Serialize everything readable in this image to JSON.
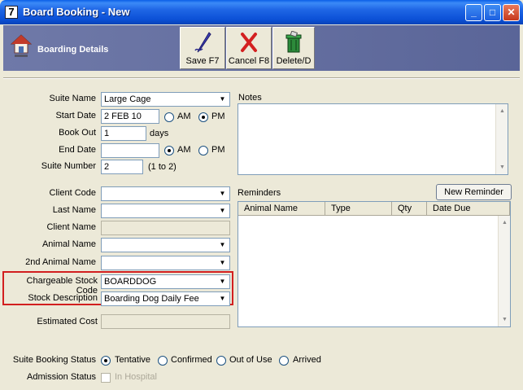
{
  "window": {
    "title": "Board Booking - New",
    "app_glyph": "7",
    "controls": {
      "minimize": "_",
      "maximize": "□",
      "close": "✕"
    }
  },
  "header": {
    "section_title": "Boarding Details",
    "icon": "house-icon",
    "toolbar": {
      "save_label": "Save F7",
      "cancel_label": "Cancel F8",
      "delete_label": "Delete/D"
    }
  },
  "form": {
    "suite_name": {
      "label": "Suite Name",
      "value": "Large Cage"
    },
    "start_date": {
      "label": "Start Date",
      "value": "2 FEB 10",
      "am": "AM",
      "pm": "PM",
      "selected": "PM"
    },
    "book_out": {
      "label": "Book Out",
      "value": "1",
      "unit": "days"
    },
    "end_date": {
      "label": "End Date",
      "value": "",
      "am": "AM",
      "pm": "PM",
      "selected": "AM"
    },
    "suite_number": {
      "label": "Suite Number",
      "value": "2",
      "range": "(1 to 2)"
    },
    "client_code": {
      "label": "Client Code",
      "value": ""
    },
    "last_name": {
      "label": "Last Name",
      "value": ""
    },
    "client_name": {
      "label": "Client Name",
      "value": ""
    },
    "animal_name": {
      "label": "Animal Name",
      "value": ""
    },
    "second_animal_name": {
      "label": "2nd Animal Name",
      "value": ""
    },
    "chargeable_stock_code": {
      "label": "Chargeable Stock Code",
      "value": "BOARDDOG"
    },
    "stock_description": {
      "label": "Stock Description",
      "value": "Boarding Dog Daily Fee"
    },
    "estimated_cost": {
      "label": "Estimated Cost",
      "value": ""
    }
  },
  "notes": {
    "label": "Notes"
  },
  "reminders": {
    "label": "Reminders",
    "new_button": "New Reminder",
    "columns": [
      "Animal Name",
      "Type",
      "Qty",
      "Date Due"
    ]
  },
  "status": {
    "label": "Suite Booking Status",
    "options": [
      "Tentative",
      "Confirmed",
      "Out of Use",
      "Arrived"
    ],
    "selected": "Tentative"
  },
  "admission": {
    "label": "Admission Status",
    "checkbox_label": "In Hospital",
    "checked": false
  },
  "colors": {
    "title_bar": "#0b50d6",
    "header_bar": "#6f79a8",
    "highlight_box": "#d21f1f",
    "window_bg": "#ece9d8"
  }
}
